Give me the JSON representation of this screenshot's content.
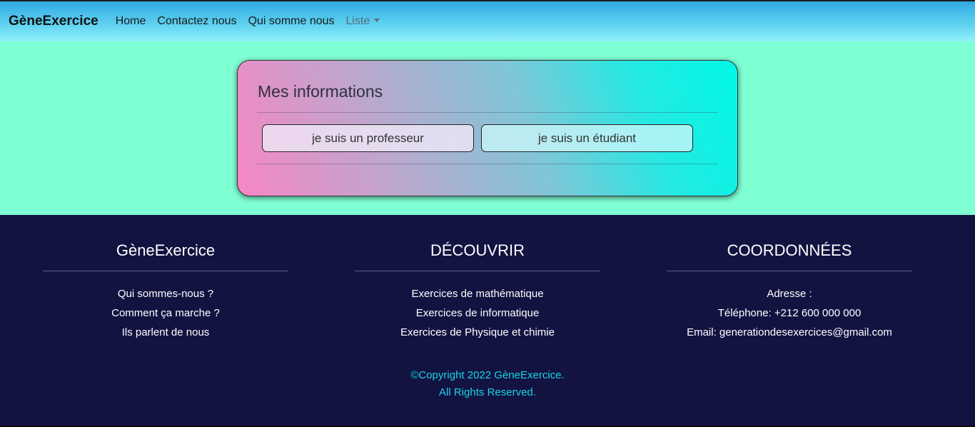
{
  "navbar": {
    "brand": "GèneExercice",
    "links": [
      "Home",
      "Contactez nous",
      "Qui somme nous"
    ],
    "dropdown_label": "Liste"
  },
  "card": {
    "title": "Mes informations",
    "btn_professeur": "je suis un professeur",
    "btn_etudiant": "je suis un étudiant"
  },
  "footer": {
    "col1": {
      "title": "GèneExercice",
      "items": [
        "Qui sommes-nous ?",
        "Comment ça marche ?",
        "Ils parlent de nous"
      ]
    },
    "col2": {
      "title": "DÉCOUVRIR",
      "items": [
        "Exercices de mathématique",
        "Exercices de informatique",
        "Exercices de Physique et chimie"
      ]
    },
    "col3": {
      "title": "COORDONNÉES",
      "items": [
        "Adresse :",
        "Téléphone: +212 600 000 000",
        "Email: generationdesexercices@gmail.com"
      ]
    },
    "copyright_line1": "©Copyright 2022 GèneExercice.",
    "copyright_line2": "All Rights Reserved."
  },
  "colors": {
    "page_bg": "#7fffd4",
    "footer_bg": "#121341",
    "copyright": "#19d3e6"
  }
}
